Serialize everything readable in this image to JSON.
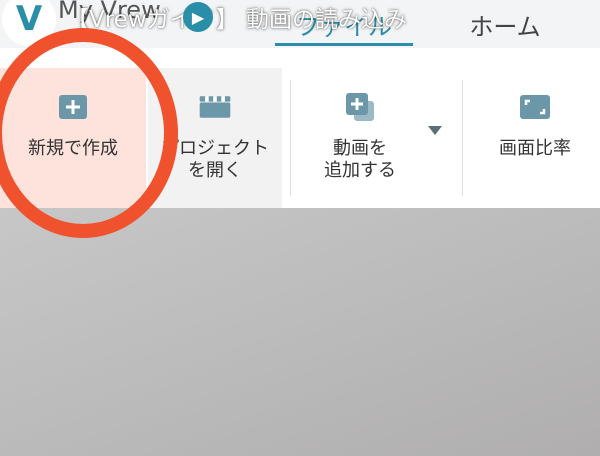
{
  "header": {
    "logo_letter": "V",
    "app_name": "My Vrew",
    "overlay_title": "【Vrewガイド】 動画の読み込み",
    "tabs": [
      {
        "label": "ファイル",
        "active": true
      },
      {
        "label": "ホーム",
        "active": false
      }
    ]
  },
  "toolbar": {
    "new_label": "新規で作成",
    "open_label": "プロジェクト\nを開く",
    "add_label": "動画を\n追加する",
    "ratio_label": "画面比率"
  },
  "colors": {
    "accent": "#2b8ea8",
    "icon": "#5b8fa2",
    "highlight": "#f0522d"
  }
}
